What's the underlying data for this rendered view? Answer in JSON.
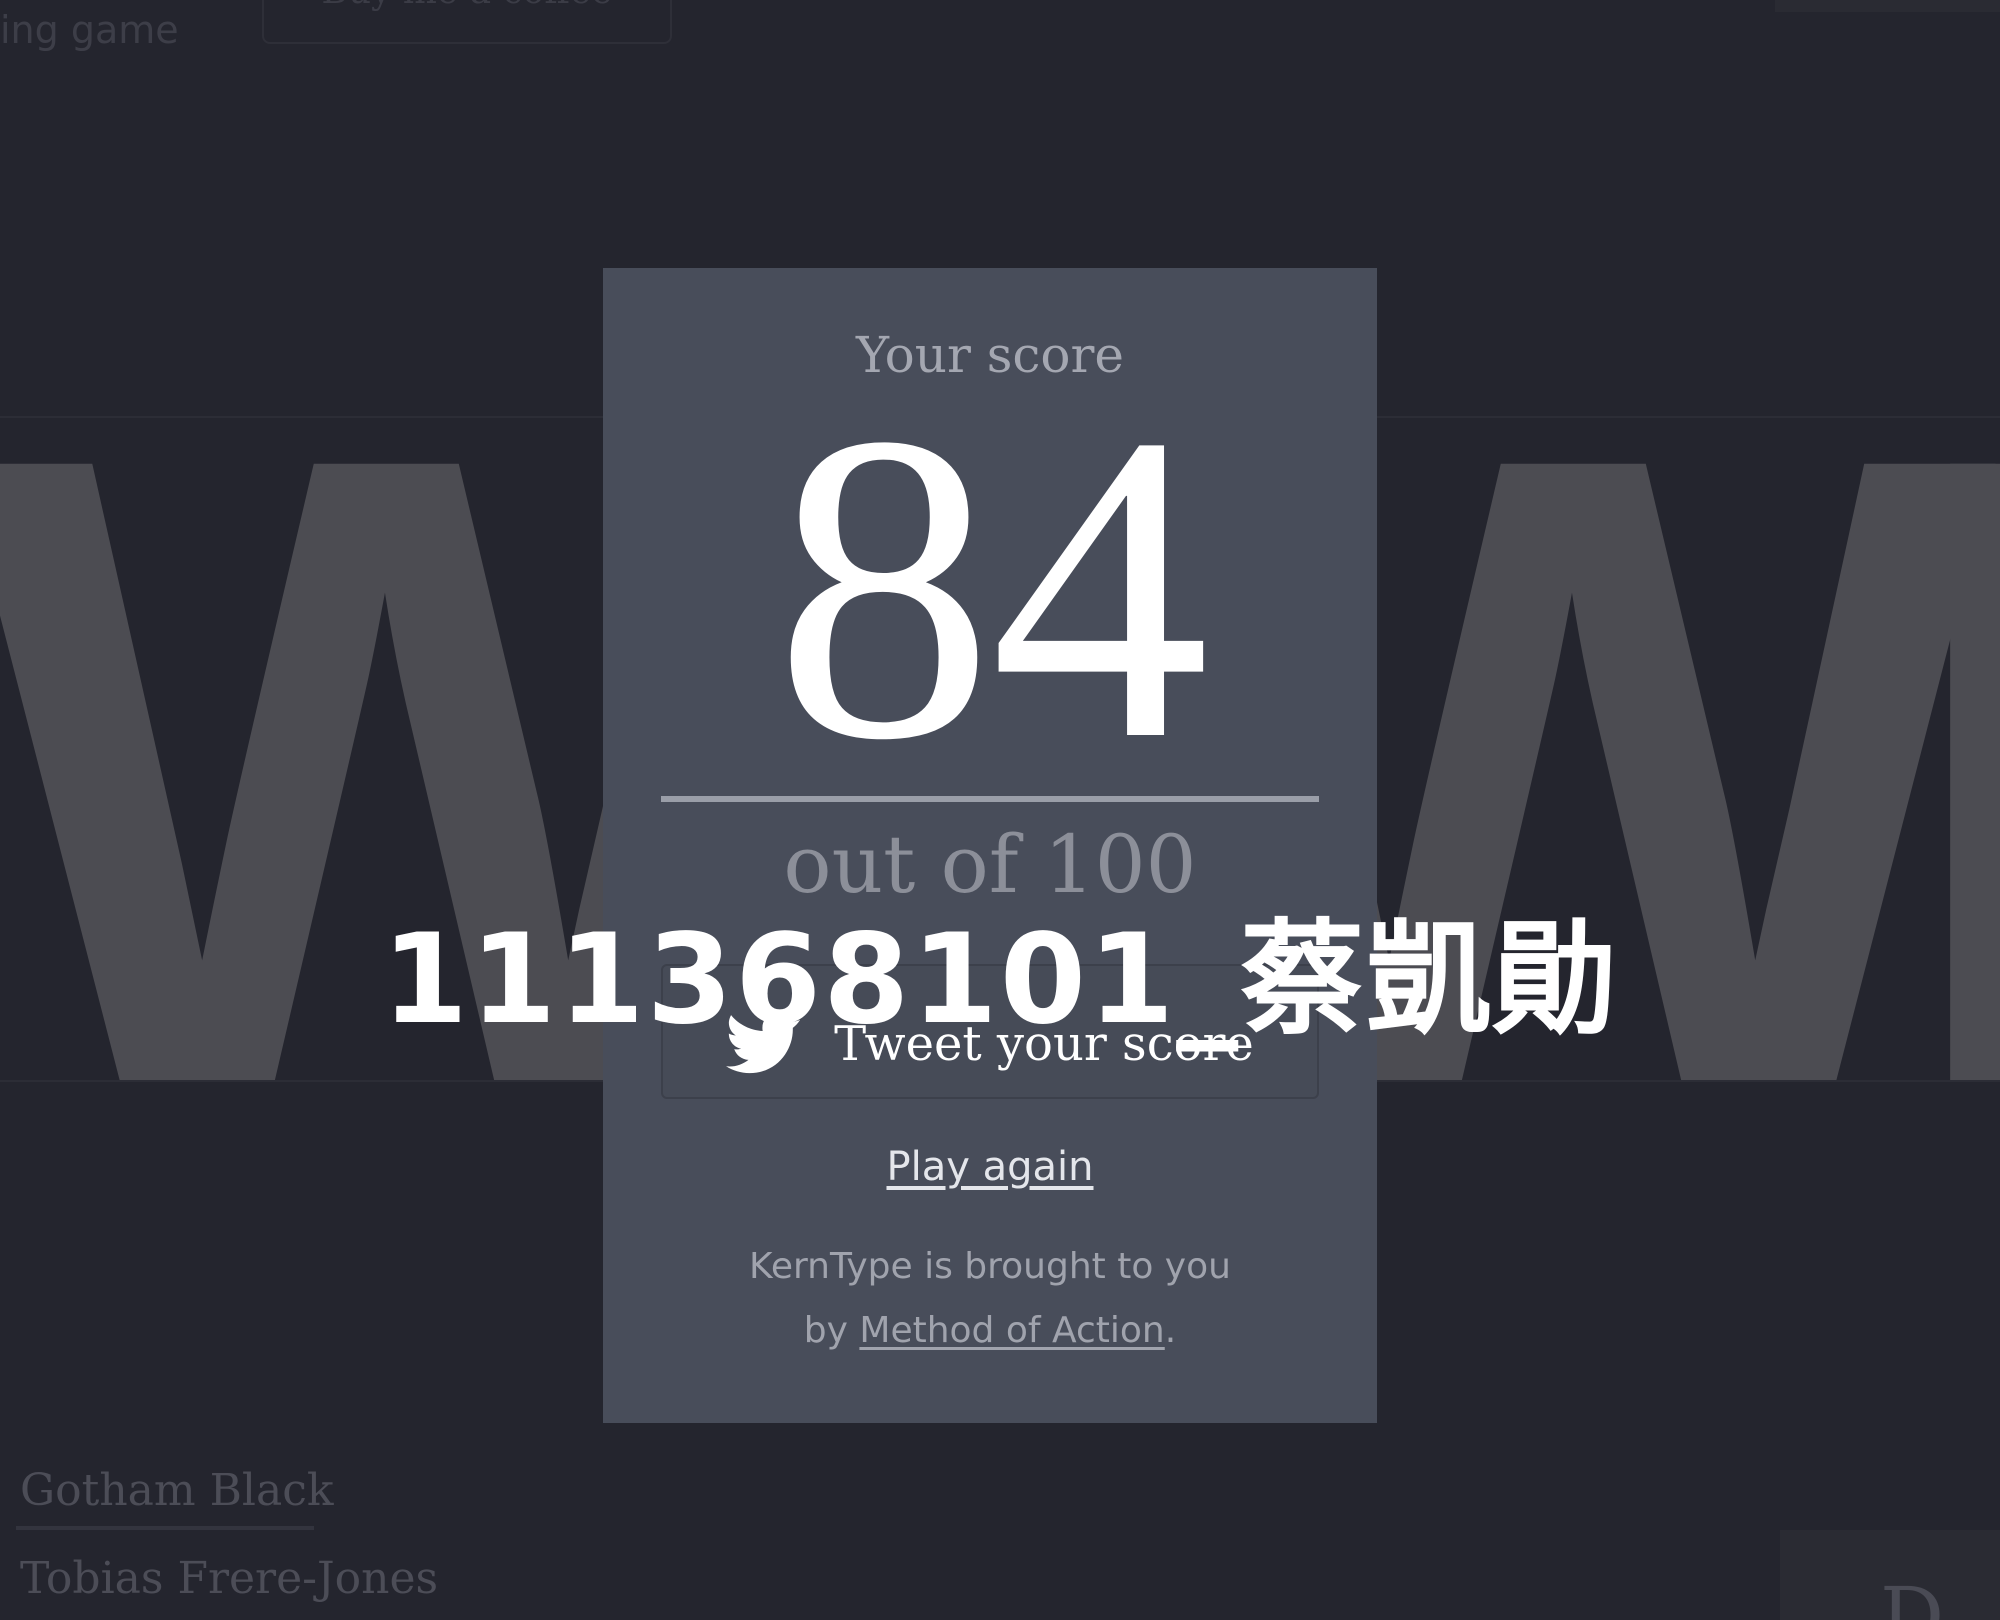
{
  "background": {
    "top_left_text": "ing game",
    "coffee_button_label": "Buy me a coffee",
    "specimen_letters": "WAWI",
    "font_name": "Gotham Black",
    "designer": "Tobias Frere-Jones",
    "bottom_right_glyph": "D"
  },
  "modal": {
    "score_label": "Your score",
    "score": "84",
    "out_of": "out of 100",
    "tweet_label": "Tweet your score",
    "play_again": "Play again",
    "credit_prefix": "KernType is brought to you",
    "credit_by": "by ",
    "credit_link": "Method of Action",
    "credit_suffix": "."
  },
  "watermark": "111368101_蔡凱勛",
  "icons": {
    "twitter": "twitter-bird-icon"
  },
  "colors": {
    "page_bg": "#24252e",
    "modal_bg": "#484d5a",
    "letter_gray": "#4c4c52"
  }
}
